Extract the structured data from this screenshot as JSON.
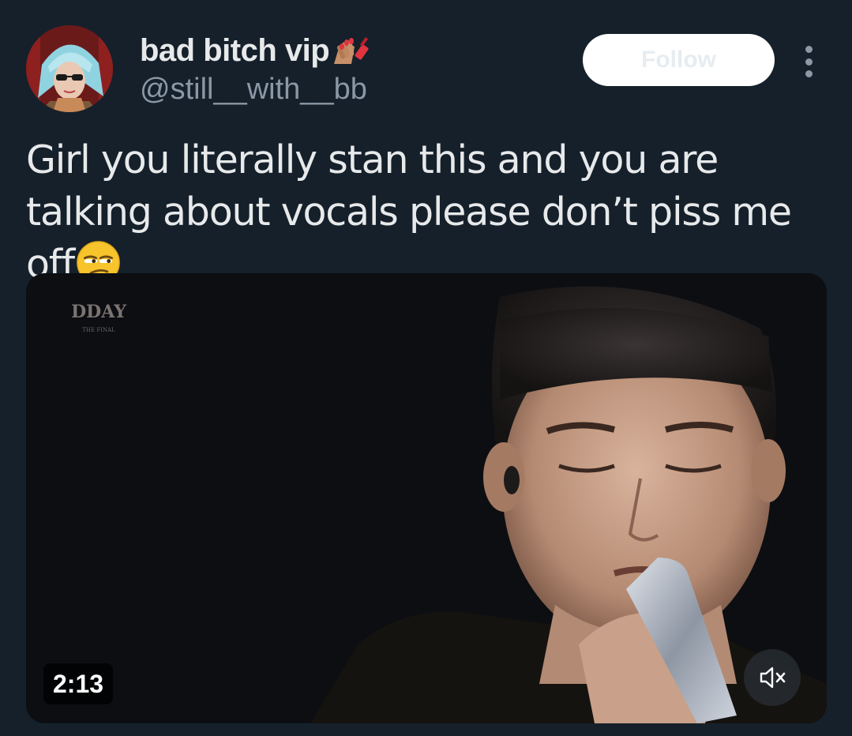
{
  "author": {
    "display_name": "bad bitch vip",
    "name_emoji": "nail-polish-emoji",
    "handle": "@still__with__bb",
    "avatar": "avatar"
  },
  "actions": {
    "follow_label": "Follow",
    "more_icon": "more-dots-icon"
  },
  "tweet": {
    "text": "Girl you literally stan this and you are talking about vocals please don’t piss me off",
    "trailing_emoji": "unamused-face-emoji"
  },
  "media": {
    "type": "video",
    "duration": "2:13",
    "mute_icon": "speaker-muted-icon"
  },
  "colors": {
    "background": "#15202b",
    "text_primary": "#e7e9ea",
    "text_secondary": "#8b98a5",
    "follow_bg": "#ffffff"
  }
}
